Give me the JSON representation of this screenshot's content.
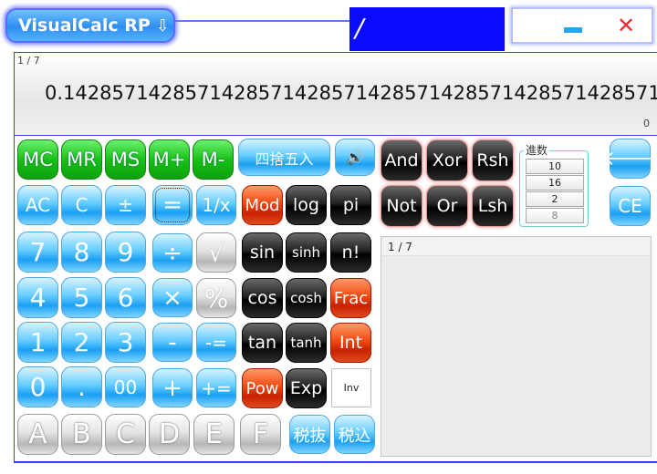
{
  "app": {
    "title": "VisualCalc RP",
    "title_arrow": "⇩"
  },
  "operator_display": "/",
  "window_controls": {
    "minimize_icon": "minimize-icon",
    "close_glyph": "✕"
  },
  "display": {
    "expression": "1 / 7",
    "result": "0.14285714285714285714285714285714285714285714285714",
    "memory": "0"
  },
  "buttons": {
    "mc": "MC",
    "mr": "MR",
    "ms": "MS",
    "mplus": "M+",
    "mminus": "M-",
    "round": "四捨五入",
    "speaker": "🔊",
    "and": "And",
    "xor": "Xor",
    "rsh": "Rsh",
    "not": "Not",
    "or": "Or",
    "lsh": "Lsh",
    "backspace": "🡐",
    "ce": "CE",
    "ac": "AC",
    "c": "C",
    "sign": "±",
    "equals": "=",
    "reciprocal": "1/x",
    "mod": "Mod",
    "log": "log",
    "pi": "pi",
    "d7": "7",
    "d8": "8",
    "d9": "9",
    "divide": "÷",
    "sqrt": "√",
    "sin": "sin",
    "sinh": "sinh",
    "fact": "n!",
    "d4": "4",
    "d5": "5",
    "d6": "6",
    "multiply": "×",
    "percent": "%",
    "cos": "cos",
    "cosh": "cosh",
    "frac": "Frac",
    "d1": "1",
    "d2": "2",
    "d3": "3",
    "minus": "-",
    "minus_eq": "-=",
    "tan": "tan",
    "tanh": "tanh",
    "int": "Int",
    "d0": "0",
    "dot": ".",
    "d00": "00",
    "plus": "+",
    "plus_eq": "+=",
    "pow": "Pow",
    "exp": "Exp",
    "inv": "Inv",
    "hexA": "A",
    "hexB": "B",
    "hexC": "C",
    "hexD": "D",
    "hexE": "E",
    "hexF": "F",
    "tax_excl": "税抜",
    "tax_incl": "税込"
  },
  "radix": {
    "label": "進数",
    "options": [
      "10",
      "16",
      "2",
      "8"
    ]
  },
  "history": {
    "items": [
      "1 / 7"
    ]
  }
}
